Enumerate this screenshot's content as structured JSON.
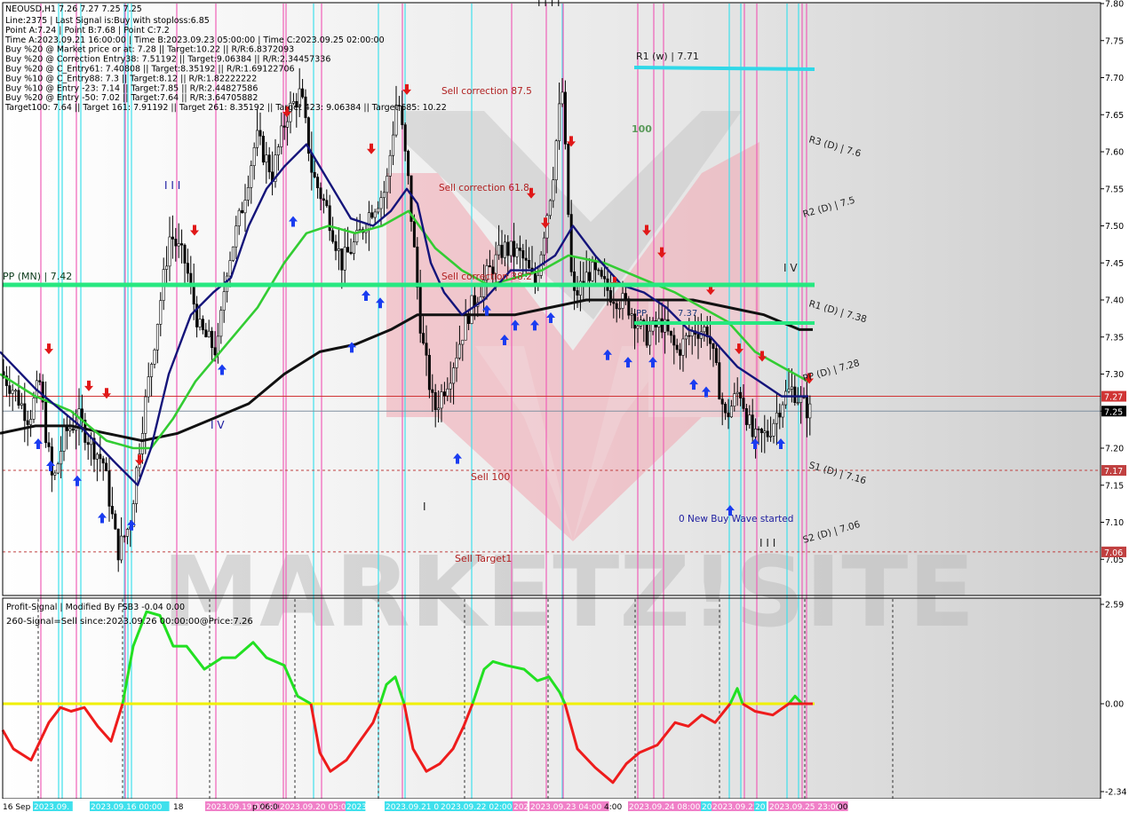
{
  "header": {
    "symbol_line": "NEOUSD,H1  7.26 7.27 7.25 7.25",
    "info_lines": [
      "Line:2375 | Last Signal is:Buy with stoploss:6.85",
      "Point A:7.24 | Point B:7.68 | Point C:7.2",
      "Time A:2023.09.21 16:00:00 | Time B:2023.09.23 05:00:00 | Time C:2023.09.25 02:00:00",
      "Buy %20 @ Market price or at: 7.28 || Target:10.22 || R/R:6.8372093",
      "Buy %20 @ Correction Entry38: 7.51192 || Target:9.06384 || R/R:2.34457336",
      "Buy %20 @ C_Entry61: 7.40808 || Target:8.35192 || R/R:1.69122706",
      "Buy %10 @ C_Entry88: 7.3 || Target:8.12 || R/R:1.82222222",
      "Buy %10 @ Entry -23: 7.14 || Target:7.85 || R/R:2.44827586",
      "Buy %20 @ Entry -50: 7.02 || Target:7.64 || R/R:3.64705882",
      "Target100: 7.64 || Target 161: 7.91192 || Target 261: 8.35192 || Target 423: 9.06384 || Target 685: 10.22"
    ]
  },
  "main_chart": {
    "price_axis_ticks": [
      "7.80",
      "7.75",
      "7.70",
      "7.65",
      "7.60",
      "7.55",
      "7.50",
      "7.45",
      "7.40",
      "7.35",
      "7.30",
      "7.25",
      "7.20",
      "7.15",
      "7.10",
      "7.05"
    ],
    "price_badges": [
      {
        "label": "7.27",
        "price": 7.27,
        "color": "#d03434"
      },
      {
        "label": "7.25",
        "price": 7.25,
        "color": "#000000"
      },
      {
        "label": "7.17",
        "price": 7.17,
        "color": "#c04040"
      },
      {
        "label": "7.06",
        "price": 7.06,
        "color": "#c04040"
      }
    ],
    "levels": {
      "pp_mn": {
        "label": "PP (MN) | 7.42",
        "price": 7.42
      },
      "r1_w": {
        "label": "R1 (w) | 7.71",
        "price": 7.71
      },
      "r3_d": {
        "label": "R3 (D) | 7.6",
        "price": 7.6
      },
      "r2_d": {
        "label": "R2 (D) | 7.5",
        "price": 7.5
      },
      "r1_d": {
        "label": "R1 (D) | 7.38",
        "price": 7.38
      },
      "pp_d": {
        "label": "PP (D) | 7.28",
        "price": 7.28
      },
      "s1_d": {
        "label": "S1 (D) | 7.16",
        "price": 7.16
      },
      "s2_d": {
        "label": "S2 (D) | 7.06",
        "price": 7.06
      },
      "short_level": {
        "label": "7.37",
        "price": 7.37
      }
    },
    "annotations": {
      "sell_correction_875": "Sell correction 87.5",
      "sell_correction_618": "Sell correction 61.8",
      "sell_correction_382": "Sell correction 38.2",
      "sell_100": "Sell 100",
      "sell_target1": "Sell  Target1",
      "new_buy_wave": "0 New Buy Wave started",
      "hundred": "100",
      "wave_iii": "I I I",
      "wave_iv": "I V",
      "wave_iv_low": "I V",
      "wave_iii_low": "I I I",
      "wave_i": "I",
      "wave_top": "I I I I",
      "pp_short": "PP",
      "watermark": "MARKETZ!SITE"
    }
  },
  "indicator": {
    "title": "Profit-Signal | Modified By FSB3 -0.04 0.00",
    "signal_text": "260-Signal=Sell since:2023.09.26 00:00:00@Price:7.26",
    "axis_ticks": [
      "2.59",
      "0.00",
      "-2.34"
    ]
  },
  "time_axis": {
    "labels": [
      "16 Sep",
      "2023.09.",
      "2023.09.16 00:00",
      "18",
      "2023.09.19 02:00",
      "p 06:00",
      "2023.09.20 05:00",
      "2023",
      "2023.09.21 07:00",
      "2023.09.22 02:00",
      "202",
      "2023.09.23 04:00",
      "4:00",
      "2023.09.24 08:00",
      "20",
      "2023.09.25",
      "20",
      "2023.09.25 23:00",
      "00"
    ]
  },
  "chart_data": {
    "type": "candlestick",
    "symbol": "NEOUSD",
    "timeframe": "H1",
    "ylim": [
      7.0,
      7.8
    ],
    "price_path": [
      [
        0,
        7.31
      ],
      [
        18,
        7.28
      ],
      [
        36,
        7.24
      ],
      [
        48,
        7.29
      ],
      [
        55,
        7.22
      ],
      [
        63,
        7.15
      ],
      [
        76,
        7.22
      ],
      [
        92,
        7.24
      ],
      [
        104,
        7.21
      ],
      [
        120,
        7.18
      ],
      [
        136,
        7.06
      ],
      [
        150,
        7.1
      ],
      [
        162,
        7.22
      ],
      [
        178,
        7.35
      ],
      [
        195,
        7.49
      ],
      [
        212,
        7.45
      ],
      [
        228,
        7.36
      ],
      [
        248,
        7.33
      ],
      [
        258,
        7.44
      ],
      [
        275,
        7.52
      ],
      [
        292,
        7.62
      ],
      [
        310,
        7.57
      ],
      [
        326,
        7.65
      ],
      [
        342,
        7.68
      ],
      [
        355,
        7.57
      ],
      [
        372,
        7.52
      ],
      [
        388,
        7.45
      ],
      [
        405,
        7.48
      ],
      [
        420,
        7.52
      ],
      [
        438,
        7.55
      ],
      [
        451,
        7.68
      ],
      [
        463,
        7.56
      ],
      [
        478,
        7.35
      ],
      [
        492,
        7.25
      ],
      [
        510,
        7.3
      ],
      [
        530,
        7.38
      ],
      [
        550,
        7.43
      ],
      [
        570,
        7.47
      ],
      [
        590,
        7.46
      ],
      [
        606,
        7.42
      ],
      [
        625,
        7.56
      ],
      [
        636,
        7.69
      ],
      [
        648,
        7.4
      ],
      [
        668,
        7.44
      ],
      [
        690,
        7.41
      ],
      [
        712,
        7.39
      ],
      [
        730,
        7.35
      ],
      [
        748,
        7.37
      ],
      [
        765,
        7.33
      ],
      [
        785,
        7.36
      ],
      [
        800,
        7.36
      ],
      [
        820,
        7.24
      ],
      [
        836,
        7.28
      ],
      [
        852,
        7.21
      ],
      [
        868,
        7.22
      ],
      [
        886,
        7.27
      ],
      [
        896,
        7.28
      ],
      [
        906,
        7.26
      ],
      [
        914,
        7.25
      ]
    ],
    "blue_ma": [
      [
        0,
        7.33
      ],
      [
        40,
        7.28
      ],
      [
        90,
        7.23
      ],
      [
        130,
        7.18
      ],
      [
        155,
        7.15
      ],
      [
        170,
        7.2
      ],
      [
        190,
        7.3
      ],
      [
        215,
        7.38
      ],
      [
        240,
        7.41
      ],
      [
        260,
        7.43
      ],
      [
        280,
        7.5
      ],
      [
        300,
        7.55
      ],
      [
        320,
        7.58
      ],
      [
        345,
        7.61
      ],
      [
        370,
        7.56
      ],
      [
        395,
        7.51
      ],
      [
        420,
        7.5
      ],
      [
        440,
        7.52
      ],
      [
        458,
        7.55
      ],
      [
        470,
        7.53
      ],
      [
        485,
        7.45
      ],
      [
        500,
        7.41
      ],
      [
        520,
        7.38
      ],
      [
        545,
        7.4
      ],
      [
        575,
        7.44
      ],
      [
        600,
        7.44
      ],
      [
        625,
        7.46
      ],
      [
        645,
        7.5
      ],
      [
        670,
        7.46
      ],
      [
        700,
        7.42
      ],
      [
        725,
        7.41
      ],
      [
        750,
        7.39
      ],
      [
        775,
        7.36
      ],
      [
        800,
        7.35
      ],
      [
        830,
        7.31
      ],
      [
        855,
        7.29
      ],
      [
        880,
        7.27
      ],
      [
        910,
        7.27
      ]
    ],
    "green_ma": [
      [
        0,
        7.3
      ],
      [
        40,
        7.27
      ],
      [
        80,
        7.25
      ],
      [
        120,
        7.21
      ],
      [
        150,
        7.2
      ],
      [
        170,
        7.2
      ],
      [
        195,
        7.24
      ],
      [
        220,
        7.29
      ],
      [
        255,
        7.34
      ],
      [
        290,
        7.39
      ],
      [
        320,
        7.45
      ],
      [
        345,
        7.49
      ],
      [
        370,
        7.5
      ],
      [
        400,
        7.49
      ],
      [
        430,
        7.5
      ],
      [
        460,
        7.52
      ],
      [
        490,
        7.47
      ],
      [
        520,
        7.44
      ],
      [
        550,
        7.42
      ],
      [
        580,
        7.43
      ],
      [
        610,
        7.44
      ],
      [
        640,
        7.46
      ],
      [
        680,
        7.45
      ],
      [
        720,
        7.43
      ],
      [
        760,
        7.41
      ],
      [
        790,
        7.39
      ],
      [
        820,
        7.37
      ],
      [
        850,
        7.33
      ],
      [
        880,
        7.31
      ],
      [
        910,
        7.29
      ]
    ],
    "black_ma": [
      [
        0,
        7.22
      ],
      [
        40,
        7.23
      ],
      [
        80,
        7.23
      ],
      [
        120,
        7.22
      ],
      [
        160,
        7.21
      ],
      [
        200,
        7.22
      ],
      [
        240,
        7.24
      ],
      [
        280,
        7.26
      ],
      [
        320,
        7.3
      ],
      [
        360,
        7.33
      ],
      [
        400,
        7.34
      ],
      [
        440,
        7.36
      ],
      [
        470,
        7.38
      ],
      [
        500,
        7.38
      ],
      [
        540,
        7.38
      ],
      [
        580,
        7.38
      ],
      [
        620,
        7.39
      ],
      [
        660,
        7.4
      ],
      [
        700,
        7.4
      ],
      [
        740,
        7.4
      ],
      [
        780,
        7.4
      ],
      [
        820,
        7.39
      ],
      [
        860,
        7.38
      ],
      [
        900,
        7.36
      ],
      [
        915,
        7.36
      ]
    ],
    "cyan_lines_x": [
      66,
      70,
      91,
      140,
      144,
      148,
      353,
      426,
      456,
      531,
      633,
      821,
      834,
      886,
      899
    ],
    "pink_lines_x": [
      46,
      86,
      141,
      199,
      243,
      319,
      322,
      362,
      453,
      576,
      615,
      634,
      718,
      736,
      747,
      838,
      852,
      903,
      908
    ],
    "buy_arrows": [
      [
        43,
        7.23
      ],
      [
        57,
        7.2
      ],
      [
        87,
        7.18
      ],
      [
        115,
        7.13
      ],
      [
        148,
        7.12
      ],
      [
        250,
        7.33
      ],
      [
        330,
        7.53
      ],
      [
        396,
        7.36
      ],
      [
        412,
        7.43
      ],
      [
        428,
        7.42
      ],
      [
        515,
        7.21
      ],
      [
        548,
        7.41
      ],
      [
        568,
        7.37
      ],
      [
        580,
        7.39
      ],
      [
        602,
        7.39
      ],
      [
        620,
        7.4
      ],
      [
        684,
        7.35
      ],
      [
        707,
        7.34
      ],
      [
        735,
        7.34
      ],
      [
        781,
        7.31
      ],
      [
        795,
        7.3
      ],
      [
        822,
        7.14
      ],
      [
        850,
        7.23
      ],
      [
        879,
        7.23
      ]
    ],
    "sell_arrows": [
      [
        55,
        7.31
      ],
      [
        100,
        7.26
      ],
      [
        120,
        7.25
      ],
      [
        157,
        7.16
      ],
      [
        219,
        7.47
      ],
      [
        323,
        7.63
      ],
      [
        355,
        7.8
      ],
      [
        418,
        7.58
      ],
      [
        458,
        7.66
      ],
      [
        598,
        7.52
      ],
      [
        614,
        7.48
      ],
      [
        643,
        7.59
      ],
      [
        692,
        7.4
      ],
      [
        728,
        7.47
      ],
      [
        745,
        7.44
      ],
      [
        800,
        7.39
      ],
      [
        832,
        7.31
      ],
      [
        858,
        7.3
      ],
      [
        911,
        7.27
      ]
    ],
    "indicator": {
      "ylim": [
        -2.34,
        2.59
      ],
      "series": [
        {
          "name": "green",
          "points": [
            [
              138,
              0.0
            ],
            [
              150,
              1.5
            ],
            [
              165,
              2.4
            ],
            [
              180,
              2.3
            ],
            [
              195,
              1.5
            ],
            [
              210,
              1.5
            ],
            [
              230,
              0.9
            ],
            [
              250,
              1.2
            ],
            [
              265,
              1.2
            ],
            [
              285,
              1.6
            ],
            [
              300,
              1.2
            ],
            [
              320,
              1.0
            ],
            [
              335,
              0.2
            ],
            [
              350,
              0.0
            ]
          ]
        },
        {
          "name": "green",
          "points": [
            [
              428,
              0.0
            ],
            [
              435,
              0.5
            ],
            [
              445,
              0.7
            ],
            [
              455,
              0.0
            ]
          ]
        },
        {
          "name": "green",
          "points": [
            [
              532,
              0.0
            ],
            [
              545,
              0.9
            ],
            [
              555,
              1.1
            ],
            [
              570,
              1.0
            ],
            [
              590,
              0.9
            ],
            [
              605,
              0.6
            ],
            [
              618,
              0.7
            ],
            [
              630,
              0.3
            ],
            [
              636,
              0.0
            ]
          ]
        },
        {
          "name": "green",
          "points": [
            [
              822,
              0.0
            ],
            [
              830,
              0.4
            ],
            [
              836,
              0.0
            ]
          ]
        },
        {
          "name": "green",
          "points": [
            [
              888,
              0.0
            ],
            [
              895,
              0.2
            ],
            [
              903,
              0.0
            ]
          ]
        },
        {
          "name": "red",
          "points": [
            [
              3,
              -0.7
            ],
            [
              15,
              -1.2
            ],
            [
              35,
              -1.5
            ],
            [
              55,
              -0.5
            ],
            [
              68,
              -0.1
            ],
            [
              80,
              -0.2
            ],
            [
              95,
              -0.1
            ],
            [
              110,
              -0.6
            ],
            [
              125,
              -1.0
            ],
            [
              138,
              0.0
            ]
          ]
        },
        {
          "name": "red",
          "points": [
            [
              350,
              0.0
            ],
            [
              360,
              -1.3
            ],
            [
              372,
              -1.8
            ],
            [
              390,
              -1.5
            ],
            [
              405,
              -1.0
            ],
            [
              420,
              -0.5
            ],
            [
              428,
              0.0
            ]
          ]
        },
        {
          "name": "red",
          "points": [
            [
              455,
              0.0
            ],
            [
              465,
              -1.2
            ],
            [
              480,
              -1.8
            ],
            [
              495,
              -1.6
            ],
            [
              510,
              -1.2
            ],
            [
              522,
              -0.6
            ],
            [
              532,
              0.0
            ]
          ]
        },
        {
          "name": "red",
          "points": [
            [
              636,
              0.0
            ],
            [
              650,
              -1.2
            ],
            [
              670,
              -1.7
            ],
            [
              690,
              -2.1
            ],
            [
              705,
              -1.6
            ],
            [
              720,
              -1.3
            ],
            [
              740,
              -1.1
            ],
            [
              760,
              -0.5
            ],
            [
              775,
              -0.6
            ],
            [
              790,
              -0.3
            ],
            [
              805,
              -0.5
            ],
            [
              822,
              0.0
            ]
          ]
        },
        {
          "name": "red",
          "points": [
            [
              836,
              0.0
            ],
            [
              850,
              -0.2
            ],
            [
              870,
              -0.3
            ],
            [
              888,
              0.0
            ],
            [
              903,
              0.0
            ],
            [
              915,
              0.0
            ]
          ]
        }
      ]
    }
  }
}
